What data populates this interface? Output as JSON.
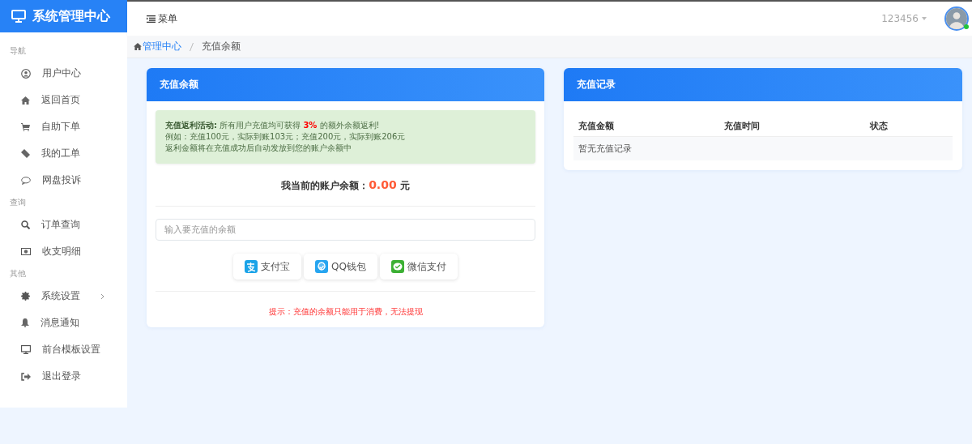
{
  "brand": {
    "title": "系统管理中心"
  },
  "topbar": {
    "menu_label": "菜单",
    "username": "123456",
    "online": true
  },
  "breadcrumb": [
    {
      "label": "管理中心",
      "link": true
    },
    {
      "label": "充值余额",
      "link": false
    }
  ],
  "sidebar": {
    "sections": [
      {
        "title": "导航",
        "items": [
          {
            "label": "用户中心",
            "expandable": false
          },
          {
            "label": "返回首页",
            "expandable": false
          },
          {
            "label": "自助下单",
            "expandable": false
          },
          {
            "label": "我的工单",
            "expandable": false
          },
          {
            "label": "网盘投诉",
            "expandable": false
          }
        ]
      },
      {
        "title": "查询",
        "items": [
          {
            "label": "订单查询",
            "expandable": false
          },
          {
            "label": "收支明细",
            "expandable": false
          }
        ]
      },
      {
        "title": "其他",
        "items": [
          {
            "label": "系统设置",
            "expandable": true
          },
          {
            "label": "消息通知",
            "expandable": false
          },
          {
            "label": "前台模板设置",
            "expandable": false
          },
          {
            "label": "退出登录",
            "expandable": false
          }
        ]
      }
    ]
  },
  "recharge_card": {
    "title": "充值余额",
    "notice": {
      "label": "充值返利活动:",
      "text_before": "所有用户充值均可获得",
      "highlight": "3%",
      "text_after": "的额外余额返利!",
      "lines": [
        "例如：充值100元，实际到账103元；充值200元，实际到账206元",
        "返利金额将在充值成功后自动发放到您的账户余额中"
      ]
    },
    "balance": {
      "label": "我当前的账户余额：",
      "amount": "0.00",
      "unit": "元"
    },
    "amount_field": {
      "placeholder": "输入要充值的余额"
    },
    "payment_buttons": [
      {
        "kind": "alipay",
        "label": "支付宝"
      },
      {
        "kind": "qq",
        "label": "QQ钱包"
      },
      {
        "kind": "wechat",
        "label": "微信支付"
      }
    ],
    "tip": "提示：充值的余额只能用于消费，无法提现"
  },
  "records_card": {
    "title": "充值记录",
    "columns": [
      "充值金额",
      "充值时间",
      "状态"
    ],
    "empty_text": "暂无充值记录"
  }
}
